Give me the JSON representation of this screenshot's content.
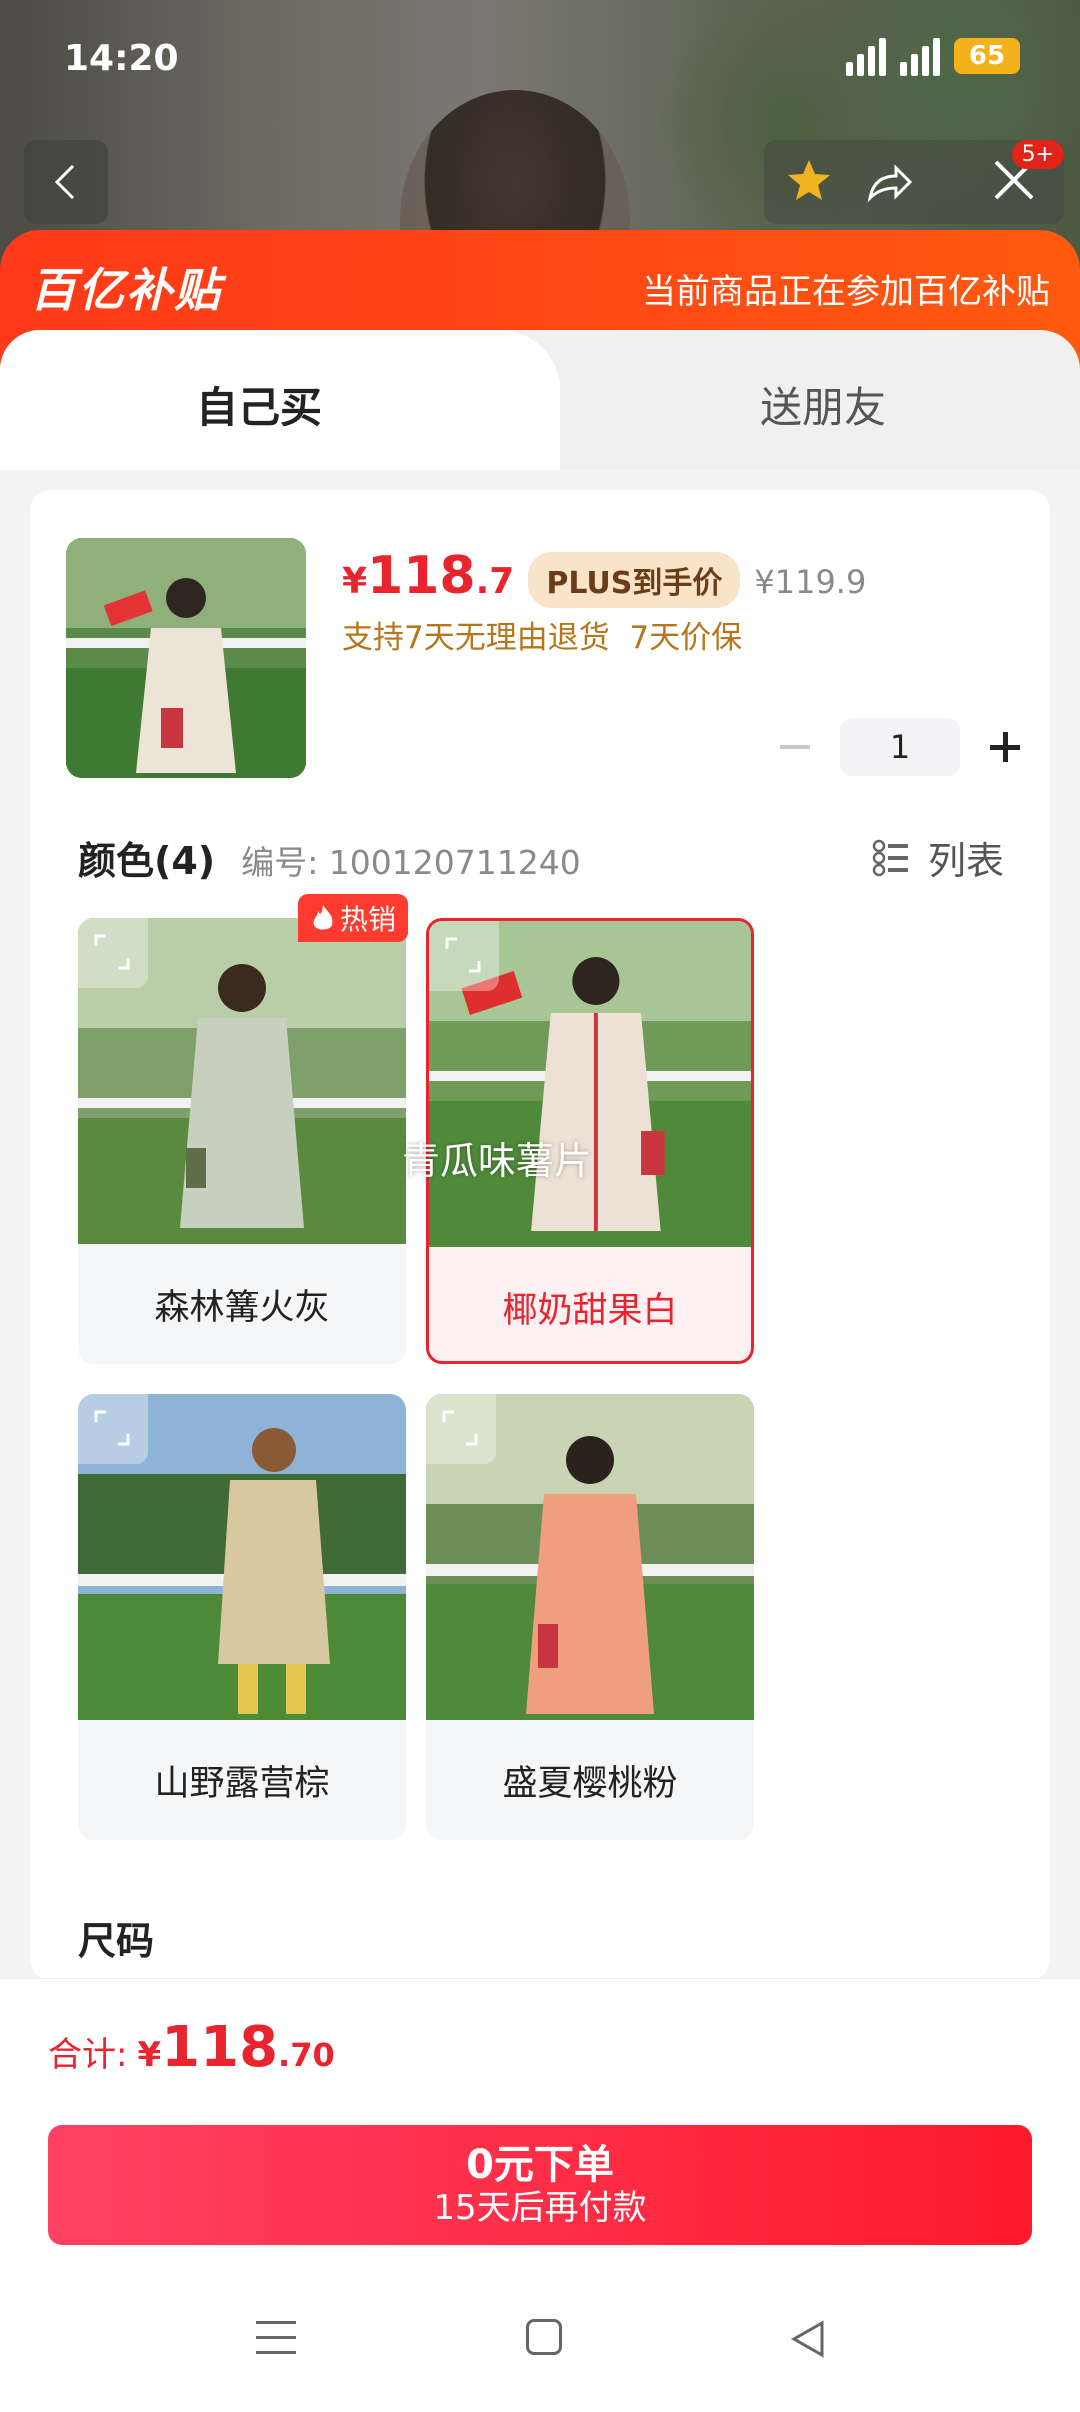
{
  "status": {
    "time": "14:20",
    "signal1": "5G",
    "signal2": "5G",
    "battery": "65"
  },
  "nav": {
    "badge": "5+"
  },
  "promo": {
    "logo": "百亿补贴",
    "text": "当前商品正在参加百亿补贴"
  },
  "tabs": [
    {
      "label": "自己买"
    },
    {
      "label": "送朋友"
    }
  ],
  "product": {
    "price_symbol": "¥",
    "price_int": "118",
    "price_dec": ".7",
    "plus_tag": "PLUS到手价",
    "orig_price": "¥119.9",
    "services": "支持7天无理由退货  7天价保",
    "quantity": "1"
  },
  "color_section": {
    "title": "颜色(4)",
    "code": "编号: 100120711240",
    "list_label": "列表",
    "hot_badge": "热销",
    "overlay_text": "青瓜味薯片",
    "options": [
      {
        "name": "森林篝火灰",
        "selected": false
      },
      {
        "name": "椰奶甜果白",
        "selected": true
      },
      {
        "name": "山野露营棕",
        "selected": false
      },
      {
        "name": "盛夏樱桃粉",
        "selected": false
      }
    ]
  },
  "size_section": {
    "title": "尺码"
  },
  "footer": {
    "total_label": "合计:",
    "total_symbol": "¥",
    "total_int": "118",
    "total_dec": ".70",
    "btn_line1": "0元下单",
    "btn_line2": "15天后再付款"
  },
  "colors": {
    "accent": "#e8252f",
    "promo": "#ff4a14",
    "plus_bg": "#f9e3c9"
  }
}
